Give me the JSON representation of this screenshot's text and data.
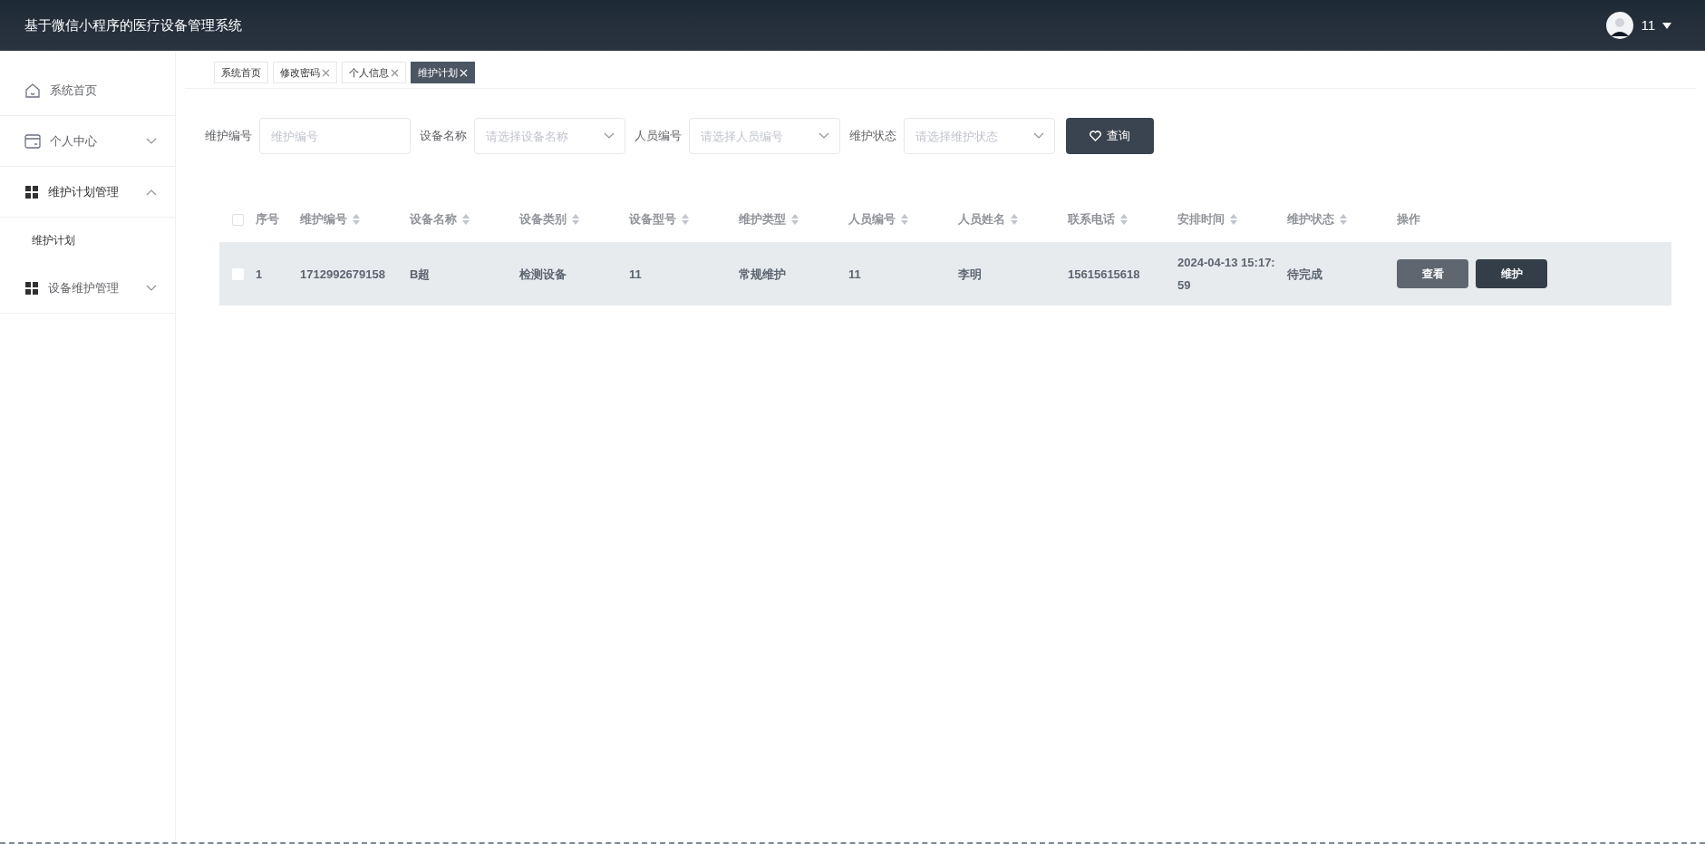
{
  "header": {
    "title": "基于微信小程序的医疗设备管理系统",
    "user": "11"
  },
  "sidebar": {
    "items": [
      {
        "label": "系统首页"
      },
      {
        "label": "个人中心",
        "expanded": false
      },
      {
        "label": "维护计划管理",
        "expanded": true,
        "children": [
          {
            "label": "维护计划"
          }
        ]
      },
      {
        "label": "设备维护管理",
        "expanded": false
      }
    ]
  },
  "tabs": [
    {
      "label": "系统首页",
      "selected": false
    },
    {
      "label": "修改密码",
      "closable": true,
      "selected": false
    },
    {
      "label": "个人信息",
      "closable": true,
      "selected": false
    },
    {
      "label": "维护计划",
      "closable": true,
      "selected": true
    }
  ],
  "filters": [
    {
      "label": "维护编号",
      "kind": "input",
      "placeholder": "维护编号"
    },
    {
      "label": "设备名称",
      "kind": "select",
      "placeholder": "请选择设备名称"
    },
    {
      "label": "人员编号",
      "kind": "select",
      "placeholder": "请选择人员编号"
    },
    {
      "label": "维护状态",
      "kind": "select",
      "placeholder": "请选择维护状态"
    }
  ],
  "search_button": "查询",
  "table": {
    "select_all_checked": false,
    "columns": [
      {
        "label": "序号",
        "sortable": false
      },
      {
        "label": "维护编号",
        "sortable": true
      },
      {
        "label": "设备名称",
        "sortable": true
      },
      {
        "label": "设备类别",
        "sortable": true
      },
      {
        "label": "设备型号",
        "sortable": true
      },
      {
        "label": "维护类型",
        "sortable": true
      },
      {
        "label": "人员编号",
        "sortable": true
      },
      {
        "label": "人员姓名",
        "sortable": true
      },
      {
        "label": "联系电话",
        "sortable": true
      },
      {
        "label": "安排时间",
        "sortable": true
      },
      {
        "label": "维护状态",
        "sortable": true
      },
      {
        "label": "操作",
        "sortable": false
      }
    ],
    "rows": [
      {
        "checked": false,
        "highlighted": true,
        "cells": [
          "1",
          "1712992679158",
          "B超",
          "检测设备",
          "11",
          "常规维护",
          "11",
          "李明",
          "15615615618",
          "2024-04-13 15:17:59",
          "待完成"
        ],
        "actions": [
          {
            "label": "查看",
            "kind": "secondary"
          },
          {
            "label": "维护",
            "kind": "primary"
          }
        ]
      }
    ]
  }
}
